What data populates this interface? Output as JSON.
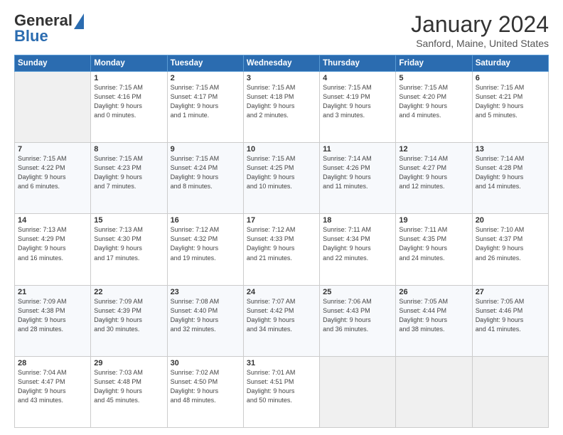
{
  "header": {
    "logo_line1": "General",
    "logo_line2": "Blue",
    "title": "January 2024",
    "subtitle": "Sanford, Maine, United States"
  },
  "days_of_week": [
    "Sunday",
    "Monday",
    "Tuesday",
    "Wednesday",
    "Thursday",
    "Friday",
    "Saturday"
  ],
  "weeks": [
    [
      {
        "day": "",
        "sunrise": "",
        "sunset": "",
        "daylight": ""
      },
      {
        "day": "1",
        "sunrise": "Sunrise: 7:15 AM",
        "sunset": "Sunset: 4:16 PM",
        "daylight": "Daylight: 9 hours and 0 minutes."
      },
      {
        "day": "2",
        "sunrise": "Sunrise: 7:15 AM",
        "sunset": "Sunset: 4:17 PM",
        "daylight": "Daylight: 9 hours and 1 minute."
      },
      {
        "day": "3",
        "sunrise": "Sunrise: 7:15 AM",
        "sunset": "Sunset: 4:18 PM",
        "daylight": "Daylight: 9 hours and 2 minutes."
      },
      {
        "day": "4",
        "sunrise": "Sunrise: 7:15 AM",
        "sunset": "Sunset: 4:19 PM",
        "daylight": "Daylight: 9 hours and 3 minutes."
      },
      {
        "day": "5",
        "sunrise": "Sunrise: 7:15 AM",
        "sunset": "Sunset: 4:20 PM",
        "daylight": "Daylight: 9 hours and 4 minutes."
      },
      {
        "day": "6",
        "sunrise": "Sunrise: 7:15 AM",
        "sunset": "Sunset: 4:21 PM",
        "daylight": "Daylight: 9 hours and 5 minutes."
      }
    ],
    [
      {
        "day": "7",
        "sunrise": "Sunrise: 7:15 AM",
        "sunset": "Sunset: 4:22 PM",
        "daylight": "Daylight: 9 hours and 6 minutes."
      },
      {
        "day": "8",
        "sunrise": "Sunrise: 7:15 AM",
        "sunset": "Sunset: 4:23 PM",
        "daylight": "Daylight: 9 hours and 7 minutes."
      },
      {
        "day": "9",
        "sunrise": "Sunrise: 7:15 AM",
        "sunset": "Sunset: 4:24 PM",
        "daylight": "Daylight: 9 hours and 8 minutes."
      },
      {
        "day": "10",
        "sunrise": "Sunrise: 7:15 AM",
        "sunset": "Sunset: 4:25 PM",
        "daylight": "Daylight: 9 hours and 10 minutes."
      },
      {
        "day": "11",
        "sunrise": "Sunrise: 7:14 AM",
        "sunset": "Sunset: 4:26 PM",
        "daylight": "Daylight: 9 hours and 11 minutes."
      },
      {
        "day": "12",
        "sunrise": "Sunrise: 7:14 AM",
        "sunset": "Sunset: 4:27 PM",
        "daylight": "Daylight: 9 hours and 12 minutes."
      },
      {
        "day": "13",
        "sunrise": "Sunrise: 7:14 AM",
        "sunset": "Sunset: 4:28 PM",
        "daylight": "Daylight: 9 hours and 14 minutes."
      }
    ],
    [
      {
        "day": "14",
        "sunrise": "Sunrise: 7:13 AM",
        "sunset": "Sunset: 4:29 PM",
        "daylight": "Daylight: 9 hours and 16 minutes."
      },
      {
        "day": "15",
        "sunrise": "Sunrise: 7:13 AM",
        "sunset": "Sunset: 4:30 PM",
        "daylight": "Daylight: 9 hours and 17 minutes."
      },
      {
        "day": "16",
        "sunrise": "Sunrise: 7:12 AM",
        "sunset": "Sunset: 4:32 PM",
        "daylight": "Daylight: 9 hours and 19 minutes."
      },
      {
        "day": "17",
        "sunrise": "Sunrise: 7:12 AM",
        "sunset": "Sunset: 4:33 PM",
        "daylight": "Daylight: 9 hours and 21 minutes."
      },
      {
        "day": "18",
        "sunrise": "Sunrise: 7:11 AM",
        "sunset": "Sunset: 4:34 PM",
        "daylight": "Daylight: 9 hours and 22 minutes."
      },
      {
        "day": "19",
        "sunrise": "Sunrise: 7:11 AM",
        "sunset": "Sunset: 4:35 PM",
        "daylight": "Daylight: 9 hours and 24 minutes."
      },
      {
        "day": "20",
        "sunrise": "Sunrise: 7:10 AM",
        "sunset": "Sunset: 4:37 PM",
        "daylight": "Daylight: 9 hours and 26 minutes."
      }
    ],
    [
      {
        "day": "21",
        "sunrise": "Sunrise: 7:09 AM",
        "sunset": "Sunset: 4:38 PM",
        "daylight": "Daylight: 9 hours and 28 minutes."
      },
      {
        "day": "22",
        "sunrise": "Sunrise: 7:09 AM",
        "sunset": "Sunset: 4:39 PM",
        "daylight": "Daylight: 9 hours and 30 minutes."
      },
      {
        "day": "23",
        "sunrise": "Sunrise: 7:08 AM",
        "sunset": "Sunset: 4:40 PM",
        "daylight": "Daylight: 9 hours and 32 minutes."
      },
      {
        "day": "24",
        "sunrise": "Sunrise: 7:07 AM",
        "sunset": "Sunset: 4:42 PM",
        "daylight": "Daylight: 9 hours and 34 minutes."
      },
      {
        "day": "25",
        "sunrise": "Sunrise: 7:06 AM",
        "sunset": "Sunset: 4:43 PM",
        "daylight": "Daylight: 9 hours and 36 minutes."
      },
      {
        "day": "26",
        "sunrise": "Sunrise: 7:05 AM",
        "sunset": "Sunset: 4:44 PM",
        "daylight": "Daylight: 9 hours and 38 minutes."
      },
      {
        "day": "27",
        "sunrise": "Sunrise: 7:05 AM",
        "sunset": "Sunset: 4:46 PM",
        "daylight": "Daylight: 9 hours and 41 minutes."
      }
    ],
    [
      {
        "day": "28",
        "sunrise": "Sunrise: 7:04 AM",
        "sunset": "Sunset: 4:47 PM",
        "daylight": "Daylight: 9 hours and 43 minutes."
      },
      {
        "day": "29",
        "sunrise": "Sunrise: 7:03 AM",
        "sunset": "Sunset: 4:48 PM",
        "daylight": "Daylight: 9 hours and 45 minutes."
      },
      {
        "day": "30",
        "sunrise": "Sunrise: 7:02 AM",
        "sunset": "Sunset: 4:50 PM",
        "daylight": "Daylight: 9 hours and 48 minutes."
      },
      {
        "day": "31",
        "sunrise": "Sunrise: 7:01 AM",
        "sunset": "Sunset: 4:51 PM",
        "daylight": "Daylight: 9 hours and 50 minutes."
      },
      {
        "day": "",
        "sunrise": "",
        "sunset": "",
        "daylight": ""
      },
      {
        "day": "",
        "sunrise": "",
        "sunset": "",
        "daylight": ""
      },
      {
        "day": "",
        "sunrise": "",
        "sunset": "",
        "daylight": ""
      }
    ]
  ]
}
